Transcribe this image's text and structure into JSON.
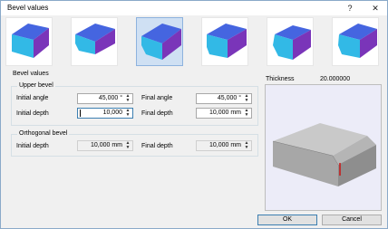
{
  "window": {
    "title": "Bevel values",
    "help_label": "?",
    "close_label": "✕"
  },
  "thumbnails": {
    "selected_index": 2,
    "items": [
      {
        "name": "bevel-type-1"
      },
      {
        "name": "bevel-type-2"
      },
      {
        "name": "bevel-type-3"
      },
      {
        "name": "bevel-type-4"
      },
      {
        "name": "bevel-type-5"
      },
      {
        "name": "bevel-type-6"
      }
    ]
  },
  "bevel_values_label": "Bevel values",
  "upper_bevel": {
    "title": "Upper bevel",
    "initial_angle_label": "Initial angle",
    "initial_angle_value": "45,000 °",
    "final_angle_label": "Final angle",
    "final_angle_value": "45,000 °",
    "initial_depth_label": "Initial depth",
    "initial_depth_value": "10,000",
    "final_depth_label": "Final depth",
    "final_depth_value": "10,000 mm"
  },
  "orthogonal_bevel": {
    "title": "Orthogonal bevel",
    "initial_depth_label": "Initial depth",
    "initial_depth_value": "10,000 mm",
    "final_depth_label": "Final depth",
    "final_depth_value": "10,000 mm"
  },
  "thickness": {
    "label": "Thickness",
    "value": "20.000000"
  },
  "buttons": {
    "ok": "OK",
    "cancel": "Cancel"
  },
  "colors": {
    "bevel_top": "#4565e0",
    "bevel_face": "#32b9e6",
    "bevel_side": "#7a35b9",
    "selection": "#cfe0f3",
    "preview_bg": "#ececf8",
    "marker": "#d40000"
  }
}
